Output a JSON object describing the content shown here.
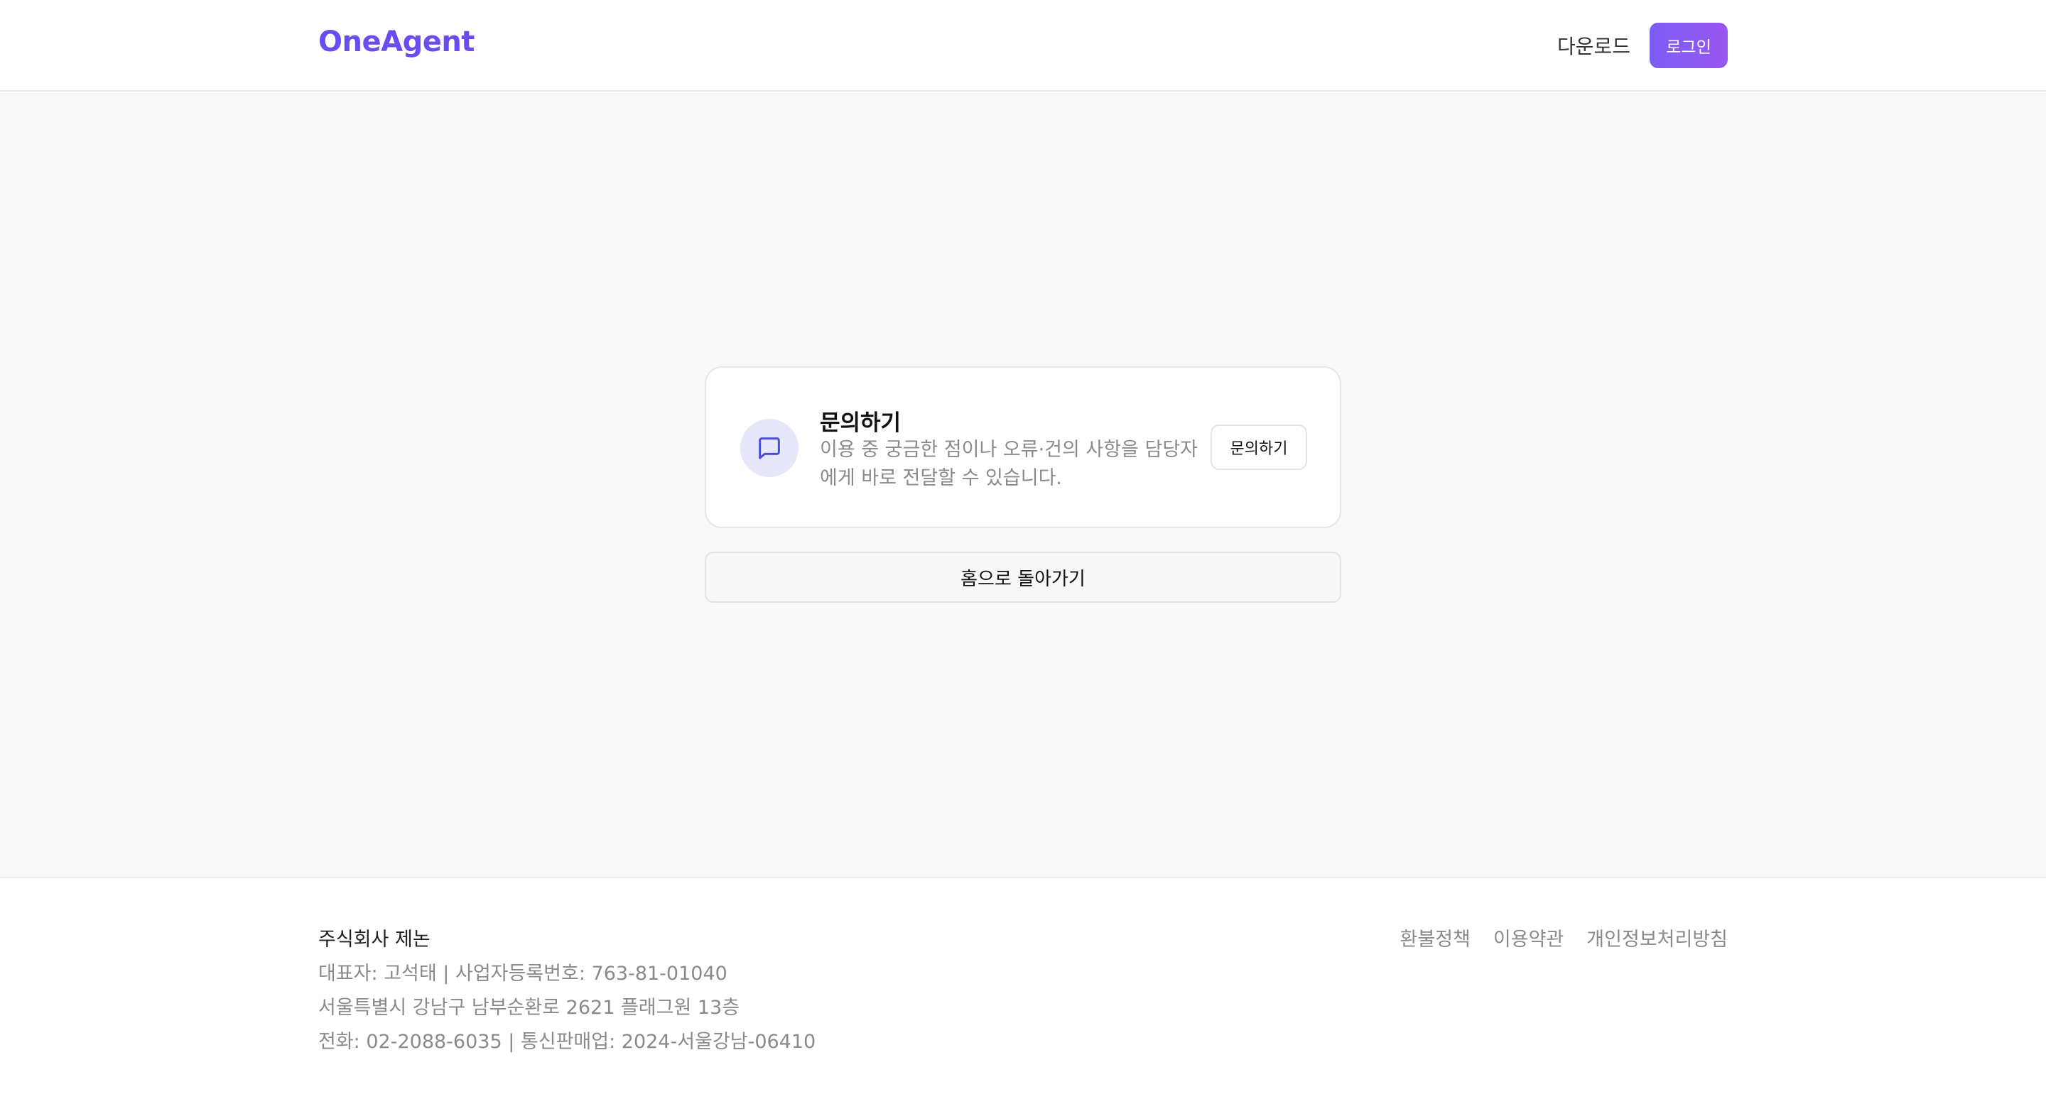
{
  "header": {
    "logo": "OneAgent",
    "download_label": "다운로드",
    "login_label": "로그인"
  },
  "card": {
    "icon": "message-square-icon",
    "title": "문의하기",
    "description": "이용 중 궁금한 점이나 오류·건의 사항을 담당자에게 바로 전달할 수 있습니다.",
    "button_label": "문의하기"
  },
  "home_button_label": "홈으로 돌아가기",
  "footer": {
    "company": "주식회사 제논",
    "line1": "대표자: 고석태 | 사업자등록번호: 763-81-01040",
    "line2": "서울특별시 강남구 남부순환로 2621 플래그원 13층",
    "line3": "전화: 02-2088-6035 | 통신판매업: 2024-서울강남-06410",
    "links": [
      "환불정책",
      "이용약관",
      "개인정보처리방침"
    ]
  },
  "colors": {
    "brand": "#6a4cf0",
    "login_gradient_start": "#7a5cf5",
    "login_gradient_end": "#9a56f0",
    "icon_bg": "#e6e7fb",
    "icon_stroke": "#4a4fd9"
  }
}
